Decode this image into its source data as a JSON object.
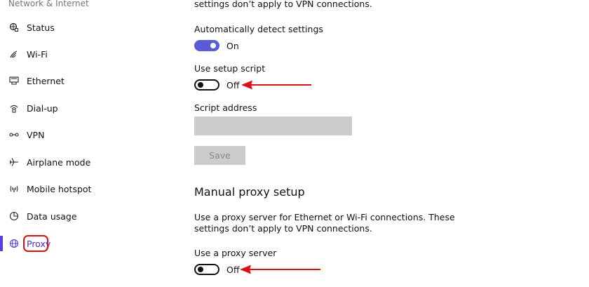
{
  "sidebar": {
    "header": "Network & Internet",
    "items": [
      {
        "label": "Status",
        "icon": "globe-plug-icon"
      },
      {
        "label": "Wi-Fi",
        "icon": "wifi-icon"
      },
      {
        "label": "Ethernet",
        "icon": "ethernet-icon"
      },
      {
        "label": "Dial-up",
        "icon": "dialup-icon"
      },
      {
        "label": "VPN",
        "icon": "vpn-icon"
      },
      {
        "label": "Airplane mode",
        "icon": "airplane-icon"
      },
      {
        "label": "Mobile hotspot",
        "icon": "hotspot-icon"
      },
      {
        "label": "Data usage",
        "icon": "data-usage-icon"
      },
      {
        "label": "Proxy",
        "icon": "globe-icon",
        "active": true
      }
    ]
  },
  "auto": {
    "top_note": "settings don’t apply to VPN connections.",
    "detect_label": "Automatically detect settings",
    "detect_state": "On",
    "script_label": "Use setup script",
    "script_state": "Off",
    "address_label": "Script address",
    "address_value": "",
    "save_label": "Save"
  },
  "manual": {
    "heading": "Manual proxy setup",
    "description_line1": "Use a proxy server for Ethernet or Wi-Fi connections. These",
    "description_line2": "settings don’t apply to VPN connections.",
    "proxy_label": "Use a proxy server",
    "proxy_state": "Off"
  },
  "colors": {
    "accent": "#5b3cdd",
    "toggle_on": "#5b5bd6",
    "annotation_red": "#e01010",
    "input_bg": "#cccccc"
  }
}
